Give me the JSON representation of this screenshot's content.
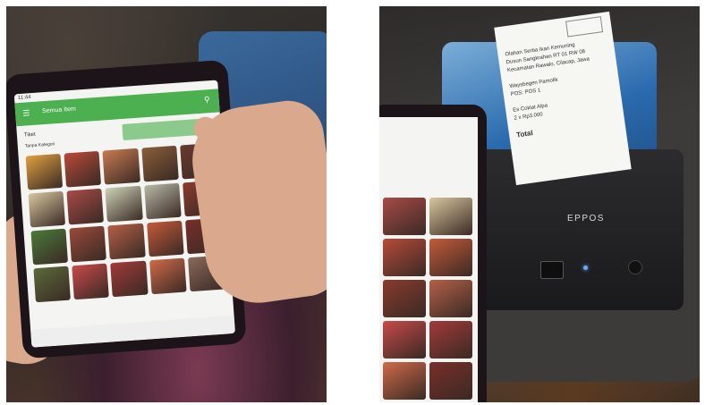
{
  "left_photo": {
    "app": {
      "status_time": "11:44",
      "toolbar_title": "Semua Item",
      "section_title": "Tiket",
      "section_sub": "Tanpa Kategori",
      "tiles": [
        "",
        "",
        "",
        "",
        "",
        "",
        "",
        "",
        "",
        "",
        "",
        "",
        "",
        "",
        "",
        "",
        "",
        "",
        "",
        ""
      ],
      "tile_colors": [
        "#e0a040",
        "#b84a3a",
        "#c97a52",
        "#8a5e3a",
        "#6a3a2e",
        "#d8c7a0",
        "#a94a48",
        "#cfd3b8",
        "#b9b9a8",
        "#8a3a2e",
        "#4a7a3a",
        "#9a4a3a",
        "#b56048",
        "#c45a3a",
        "#7a2e2a",
        "#5a6a3a",
        "#c84a4a",
        "#a23a3a",
        "#d06a4a",
        "#8a6a5a"
      ]
    }
  },
  "right_photo": {
    "printer": {
      "brand": "EPPOS"
    },
    "receipt": {
      "lines": [
        "Olahan Serba Ikan Kemuning",
        "Dusun Sangkrahan RT 01 RW 08",
        "Kecamatan Rawalo, Cilacap, Jawa",
        "",
        "Waysbegen Pamolik",
        "POS: POS 1",
        "",
        "Es Coklat Alpa",
        "2 x Rp3.000",
        "",
        "Total"
      ]
    },
    "app": {
      "tiles": [
        "",
        "",
        "",
        "",
        "",
        "",
        "",
        "",
        "",
        ""
      ],
      "tile_colors": [
        "#a94a48",
        "#d8c7a0",
        "#b84a3a",
        "#c45a3a",
        "#8a3a2e",
        "#b56048",
        "#c84a4a",
        "#a23a3a",
        "#d06a4a",
        "#7a2e2a"
      ]
    }
  },
  "colors": {
    "app_green": "#4caf50",
    "printer_blue": "#2a6db5"
  }
}
